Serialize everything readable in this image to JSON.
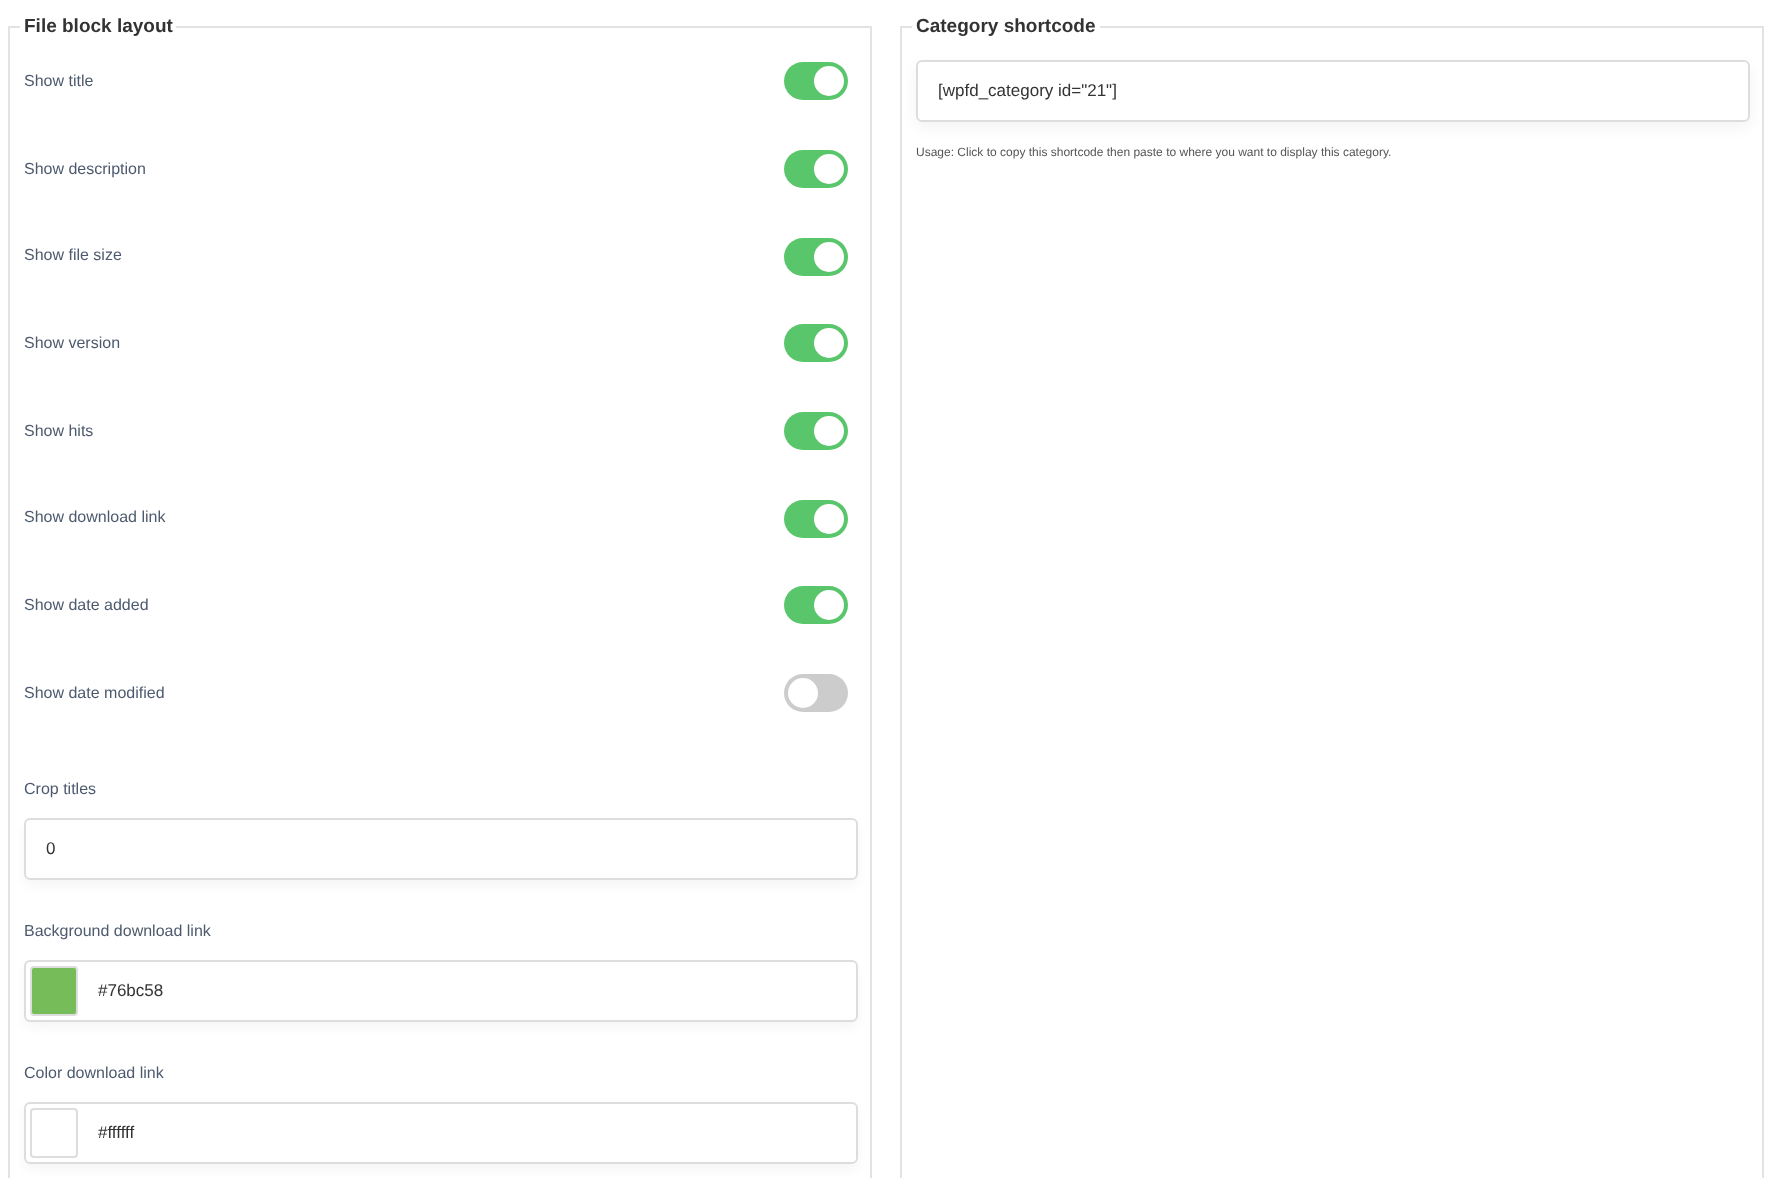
{
  "file_block_layout": {
    "legend": "File block layout",
    "toggles": [
      {
        "label": "Show title",
        "on": true
      },
      {
        "label": "Show description",
        "on": true
      },
      {
        "label": "Show file size",
        "on": true
      },
      {
        "label": "Show version",
        "on": true
      },
      {
        "label": "Show hits",
        "on": true
      },
      {
        "label": "Show download link",
        "on": true
      },
      {
        "label": "Show date added",
        "on": true
      },
      {
        "label": "Show date modified",
        "on": false
      }
    ],
    "fields": [
      {
        "kind": "text",
        "label": "Crop titles",
        "value": "0"
      },
      {
        "kind": "color",
        "label": "Background download link",
        "value": "#76bc58",
        "color": "#76bc58"
      },
      {
        "kind": "color",
        "label": "Color download link",
        "value": "#ffffff",
        "color": "#ffffff"
      }
    ]
  },
  "category_shortcode": {
    "legend": "Category shortcode",
    "value": "[wpfd_category id=\"21\"]",
    "usage": "Usage: Click to copy this shortcode then paste to where you want to display this category."
  }
}
